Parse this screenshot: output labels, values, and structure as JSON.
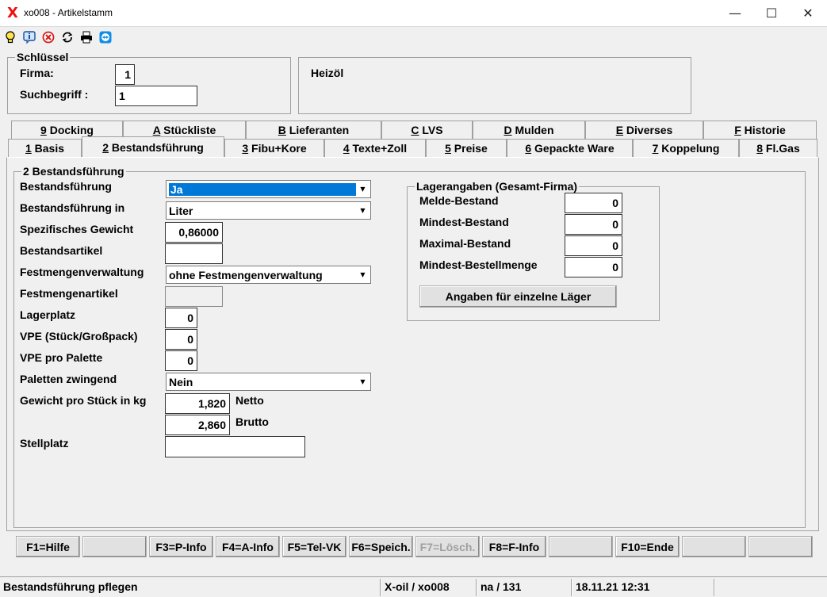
{
  "window": {
    "logo": "X",
    "title": "xo008 - Artikelstamm"
  },
  "toolbar": {
    "icons": [
      "bulb-icon",
      "info-icon",
      "cancel-icon",
      "refresh-icon",
      "print-icon",
      "teamviewer-icon"
    ]
  },
  "key": {
    "legend": "Schlüssel",
    "firma_label": "Firma:",
    "firma_value": "1",
    "suchbegriff_label": "Suchbegriff :",
    "suchbegriff_value": "1"
  },
  "product": {
    "name": "Heizöl"
  },
  "tabs_row1": [
    {
      "key": "9",
      "rest": " Docking"
    },
    {
      "key": "A",
      "rest": " Stückliste"
    },
    {
      "key": "B",
      "rest": " Lieferanten"
    },
    {
      "key": "C",
      "rest": " LVS"
    },
    {
      "key": "D",
      "rest": " Mulden"
    },
    {
      "key": "E",
      "rest": " Diverses"
    },
    {
      "key": "F",
      "rest": " Historie"
    }
  ],
  "tabs_row2": [
    {
      "key": "1",
      "rest": " Basis"
    },
    {
      "key": "2",
      "rest": " Bestandsführung"
    },
    {
      "key": "3",
      "rest": " Fibu+Kore"
    },
    {
      "key": "4",
      "rest": " Texte+Zoll"
    },
    {
      "key": "5",
      "rest": " Preise"
    },
    {
      "key": "6",
      "rest": " Gepackte Ware"
    },
    {
      "key": "7",
      "rest": " Koppelung"
    },
    {
      "key": "8",
      "rest": " Fl.Gas"
    }
  ],
  "panel": {
    "legend": "2 Bestandsführung",
    "bestandsfuehrung": {
      "label": "Bestandsführung",
      "value": "Ja"
    },
    "bestandsfuehrung_in": {
      "label": "Bestandsführung in",
      "value": "Liter"
    },
    "spez_gewicht": {
      "label": "Spezifisches Gewicht",
      "value": "0,86000"
    },
    "bestandsartikel": {
      "label": "Bestandsartikel",
      "value": ""
    },
    "festmengenverwaltung": {
      "label": "Festmengenverwaltung",
      "value": "ohne Festmengenverwaltung"
    },
    "festmengenartikel": {
      "label": "Festmengenartikel",
      "value": ""
    },
    "lagerplatz": {
      "label": "Lagerplatz",
      "value": "0"
    },
    "vpe_stueck": {
      "label": "VPE (Stück/Großpack)",
      "value": "0"
    },
    "vpe_palette": {
      "label": "VPE pro Palette",
      "value": "0"
    },
    "paletten_zwingend": {
      "label": "Paletten zwingend",
      "value": "Nein"
    },
    "gewicht": {
      "label": "Gewicht pro Stück in kg",
      "netto_value": "1,820",
      "netto_label": "Netto",
      "brutto_value": "2,860",
      "brutto_label": "Brutto"
    },
    "stellplatz": {
      "label": "Stellplatz",
      "value": ""
    }
  },
  "lager": {
    "legend": "Lagerangaben (Gesamt-Firma)",
    "melde": {
      "label": "Melde-Bestand",
      "value": "0"
    },
    "mindest": {
      "label": "Mindest-Bestand",
      "value": "0"
    },
    "maximal": {
      "label": "Maximal-Bestand",
      "value": "0"
    },
    "bestellmenge": {
      "label": "Mindest-Bestellmenge",
      "value": "0"
    },
    "button": "Angaben für einzelne Läger"
  },
  "fkeys": [
    "F1=Hilfe",
    "",
    "F3=P-Info",
    "F4=A-Info",
    "F5=Tel-VK",
    "F6=Speich.",
    "F7=Lösch.",
    "F8=F-Info",
    "",
    "F10=Ende",
    "",
    ""
  ],
  "status": {
    "message": "Bestandsführung pflegen",
    "program": "X-oil / xo008",
    "user": "na / 131",
    "datetime": "18.11.21 12:31"
  }
}
